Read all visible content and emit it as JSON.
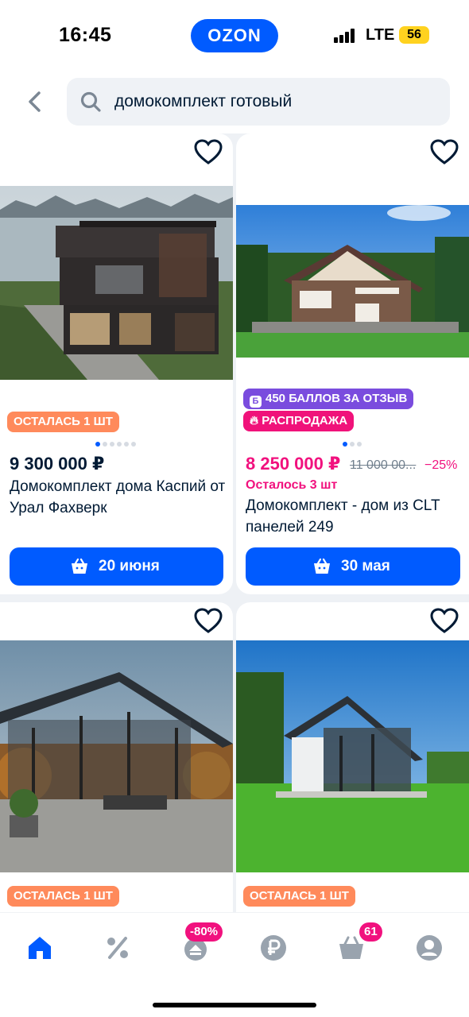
{
  "status": {
    "time": "16:45",
    "network": "LTE",
    "battery": "56",
    "logo": "OZON"
  },
  "search": {
    "query": "домокомплект готовый"
  },
  "products": [
    {
      "badges": [
        "ОСТАЛАСЬ 1 ШТ"
      ],
      "price": "9 300 000 ₽",
      "title": "Домокомплект дома Каспий от Урал Фахверк",
      "delivery": "20 июня"
    },
    {
      "badges": [
        "450 БАЛЛОВ ЗА ОТЗЫВ",
        "РАСПРОДАЖА"
      ],
      "price": "8 250 000 ₽",
      "old_price": "11 000 00...",
      "discount": "−25%",
      "stock": "Осталось 3 шт",
      "title": "Домокомплект - дом из CLT панелей 249",
      "delivery": "30 мая"
    },
    {
      "badges": [
        "ОСТАЛАСЬ 1 ШТ"
      ]
    },
    {
      "badges": [
        "ОСТАЛАСЬ 1 ШТ"
      ]
    }
  ],
  "nav": {
    "items": [
      "home-icon",
      "percent-icon",
      "fresh-icon",
      "ruble-icon",
      "cart-icon",
      "profile-icon"
    ],
    "discount_badge": "-80%",
    "cart_count": "61"
  },
  "colors": {
    "accent": "#005bff",
    "sale": "#f1117e",
    "badge_orange": "#ff8a5b",
    "badge_purple": "#7a4cde"
  }
}
